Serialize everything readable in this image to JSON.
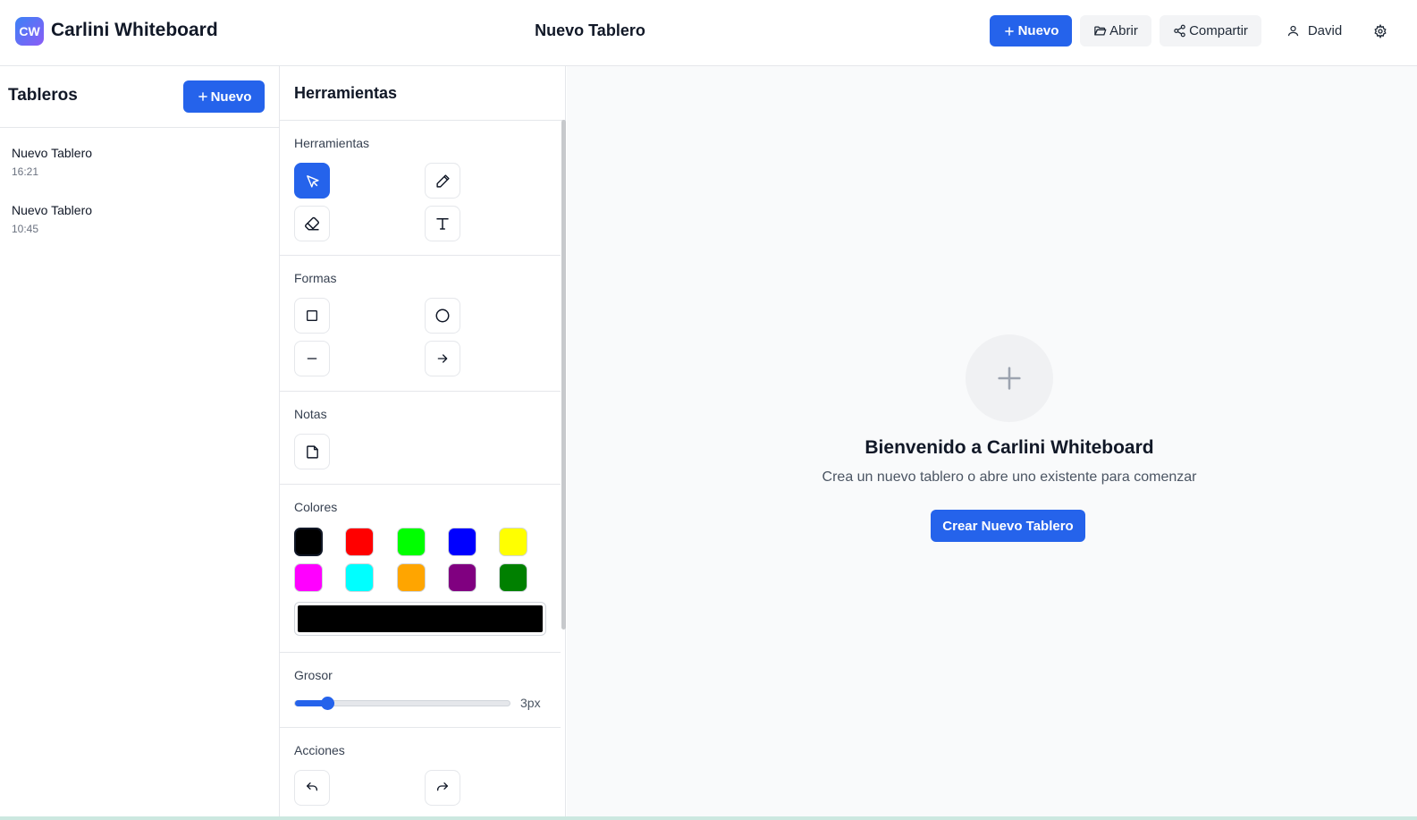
{
  "header": {
    "logo_text": "CW",
    "app_title": "Carlini Whiteboard",
    "board_title": "Nuevo Tablero",
    "new_label": "Nuevo",
    "open_label": "Abrir",
    "share_label": "Compartir",
    "user_name": "David"
  },
  "sidebar": {
    "title": "Tableros",
    "new_label": "Nuevo",
    "boards": [
      {
        "name": "Nuevo Tablero",
        "time": "16:21"
      },
      {
        "name": "Nuevo Tablero",
        "time": "10:45"
      }
    ]
  },
  "tools": {
    "title": "Herramientas",
    "sections": {
      "tools": "Herramientas",
      "shapes": "Formas",
      "notes": "Notas",
      "colors": "Colores",
      "thickness": "Grosor",
      "actions": "Acciones"
    },
    "tool_icons": [
      "cursor-icon",
      "pencil-icon",
      "eraser-icon",
      "text-icon"
    ],
    "active_tool": "cursor",
    "shape_icons": [
      "square-icon",
      "circle-icon",
      "line-icon",
      "arrow-icon"
    ],
    "note_icons": [
      "sticky-note-icon"
    ],
    "colors": [
      "#000000",
      "#ff0000",
      "#00ff00",
      "#0000ff",
      "#ffff00",
      "#ff00ff",
      "#00ffff",
      "#ffa500",
      "#800080",
      "#008000"
    ],
    "selected_color": "#000000",
    "thickness_value": 3,
    "thickness_max": 20,
    "thickness_label": "3px",
    "action_icons": [
      "undo-icon",
      "redo-icon"
    ]
  },
  "canvas": {
    "welcome_title": "Bienvenido a Carlini Whiteboard",
    "welcome_subtitle": "Crea un nuevo tablero o abre uno existente para comenzar",
    "create_button": "Crear Nuevo Tablero"
  },
  "colors": {
    "accent": "#2563eb",
    "logo_gradient_start": "#3b82f6",
    "logo_gradient_end": "#8b5cf6"
  }
}
